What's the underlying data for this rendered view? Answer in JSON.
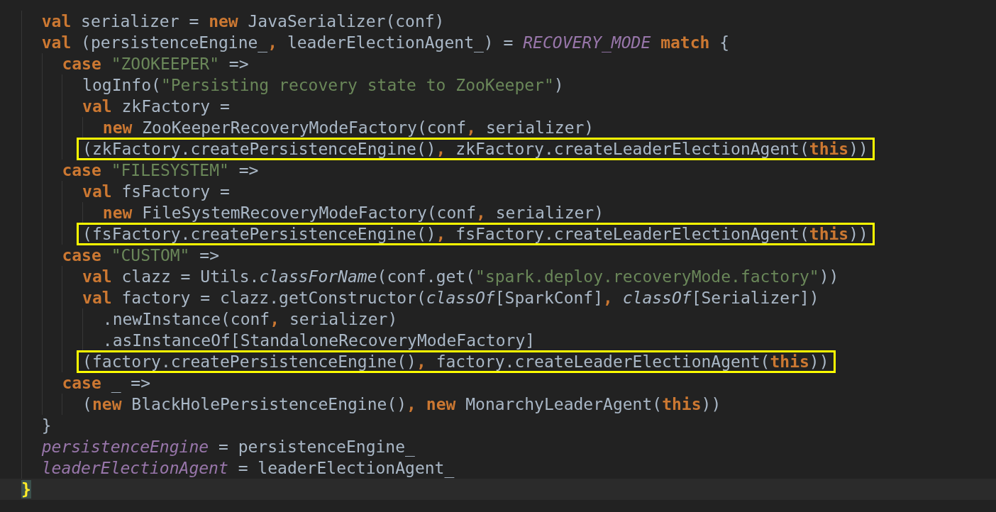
{
  "editor": {
    "lines": [
      {
        "tokens": [
          {
            "kind": "kw",
            "text": "  val"
          },
          {
            "kind": "plain",
            "text": " serializer = "
          },
          {
            "kind": "kw",
            "text": "new"
          },
          {
            "kind": "plain",
            "text": " JavaSerializer(conf)"
          }
        ]
      },
      {
        "tokens": [
          {
            "kind": "kw",
            "text": "  val"
          },
          {
            "kind": "plain",
            "text": " (persistenceEngine_"
          },
          {
            "kind": "kw",
            "text": ","
          },
          {
            "kind": "plain",
            "text": " leaderElectionAgent_) = "
          },
          {
            "kind": "field",
            "text": "RECOVERY_MODE "
          },
          {
            "kind": "kw",
            "text": "match"
          },
          {
            "kind": "plain",
            "text": " {"
          }
        ]
      },
      {
        "tokens": [
          {
            "kind": "kw",
            "text": "    case "
          },
          {
            "kind": "str",
            "text": "\"ZOOKEEPER\""
          },
          {
            "kind": "plain",
            "text": " =>"
          }
        ]
      },
      {
        "tokens": [
          {
            "kind": "plain",
            "text": "      logInfo("
          },
          {
            "kind": "str",
            "text": "\"Persisting recovery state to ZooKeeper\""
          },
          {
            "kind": "plain",
            "text": ")"
          }
        ]
      },
      {
        "tokens": [
          {
            "kind": "kw",
            "text": "      val"
          },
          {
            "kind": "plain",
            "text": " zkFactory ="
          }
        ]
      },
      {
        "tokens": [
          {
            "kind": "kw",
            "text": "        new"
          },
          {
            "kind": "plain",
            "text": " ZooKeeperRecoveryModeFactory(conf"
          },
          {
            "kind": "kw",
            "text": ","
          },
          {
            "kind": "plain",
            "text": " serializer)"
          }
        ]
      },
      {
        "boxed": true,
        "tokens": [
          {
            "kind": "plain",
            "text": "      (zkFactory.createPersistenceEngine()"
          },
          {
            "kind": "kw",
            "text": ","
          },
          {
            "kind": "plain",
            "text": " zkFactory.createLeaderElectionAgent("
          },
          {
            "kind": "kw",
            "text": "this"
          },
          {
            "kind": "plain",
            "text": "))"
          }
        ]
      },
      {
        "tokens": [
          {
            "kind": "kw",
            "text": "    case "
          },
          {
            "kind": "str",
            "text": "\"FILESYSTEM\""
          },
          {
            "kind": "plain",
            "text": " =>"
          }
        ]
      },
      {
        "tokens": [
          {
            "kind": "kw",
            "text": "      val"
          },
          {
            "kind": "plain",
            "text": " fsFactory ="
          }
        ]
      },
      {
        "tokens": [
          {
            "kind": "kw",
            "text": "        new"
          },
          {
            "kind": "plain",
            "text": " FileSystemRecoveryModeFactory(conf"
          },
          {
            "kind": "kw",
            "text": ","
          },
          {
            "kind": "plain",
            "text": " serializer)"
          }
        ]
      },
      {
        "boxed": true,
        "tokens": [
          {
            "kind": "plain",
            "text": "      (fsFactory.createPersistenceEngine()"
          },
          {
            "kind": "kw",
            "text": ","
          },
          {
            "kind": "plain",
            "text": " fsFactory.createLeaderElectionAgent("
          },
          {
            "kind": "kw",
            "text": "this"
          },
          {
            "kind": "plain",
            "text": "))"
          }
        ]
      },
      {
        "tokens": [
          {
            "kind": "kw",
            "text": "    case "
          },
          {
            "kind": "str",
            "text": "\"CUSTOM\""
          },
          {
            "kind": "plain",
            "text": " =>"
          }
        ]
      },
      {
        "tokens": [
          {
            "kind": "kw",
            "text": "      val"
          },
          {
            "kind": "plain",
            "text": " clazz = Utils."
          },
          {
            "kind": "method",
            "text": "classForName"
          },
          {
            "kind": "plain",
            "text": "(conf.get("
          },
          {
            "kind": "str",
            "text": "\"spark.deploy.recoveryMode.factory\""
          },
          {
            "kind": "plain",
            "text": "))"
          }
        ]
      },
      {
        "tokens": [
          {
            "kind": "kw",
            "text": "      val"
          },
          {
            "kind": "plain",
            "text": " factory = clazz.getConstructor("
          },
          {
            "kind": "method",
            "text": "classOf"
          },
          {
            "kind": "plain",
            "text": "[SparkConf]"
          },
          {
            "kind": "kw",
            "text": ", "
          },
          {
            "kind": "method",
            "text": "classOf"
          },
          {
            "kind": "plain",
            "text": "[Serializer])"
          }
        ]
      },
      {
        "tokens": [
          {
            "kind": "plain",
            "text": "        .newInstance(conf"
          },
          {
            "kind": "kw",
            "text": ","
          },
          {
            "kind": "plain",
            "text": " serializer)"
          }
        ]
      },
      {
        "tokens": [
          {
            "kind": "plain",
            "text": "        .asInstanceOf[StandaloneRecoveryModeFactory]"
          }
        ]
      },
      {
        "boxed": true,
        "tokens": [
          {
            "kind": "plain",
            "text": "      (factory.createPersistenceEngine()"
          },
          {
            "kind": "kw",
            "text": ","
          },
          {
            "kind": "plain",
            "text": " factory.createLeaderElectionAgent("
          },
          {
            "kind": "kw",
            "text": "this"
          },
          {
            "kind": "plain",
            "text": "))"
          }
        ]
      },
      {
        "tokens": [
          {
            "kind": "kw",
            "text": "    case"
          },
          {
            "kind": "plain",
            "text": " _ =>"
          }
        ]
      },
      {
        "tokens": [
          {
            "kind": "plain",
            "text": "      ("
          },
          {
            "kind": "kw",
            "text": "new"
          },
          {
            "kind": "plain",
            "text": " BlackHolePersistenceEngine()"
          },
          {
            "kind": "kw",
            "text": ", new"
          },
          {
            "kind": "plain",
            "text": " MonarchyLeaderAgent("
          },
          {
            "kind": "kw",
            "text": "this"
          },
          {
            "kind": "plain",
            "text": "))"
          }
        ]
      },
      {
        "tokens": [
          {
            "kind": "plain",
            "text": "  }"
          }
        ]
      },
      {
        "tokens": [
          {
            "kind": "field",
            "text": "  persistenceEngine"
          },
          {
            "kind": "plain",
            "text": " = persistenceEngine_"
          }
        ]
      },
      {
        "tokens": [
          {
            "kind": "field",
            "text": "  leaderElectionAgent"
          },
          {
            "kind": "plain",
            "text": " = leaderElectionAgent_"
          }
        ]
      },
      {
        "current": true,
        "tokens": [
          {
            "kind": "brace-match",
            "text": "}"
          }
        ]
      }
    ]
  }
}
